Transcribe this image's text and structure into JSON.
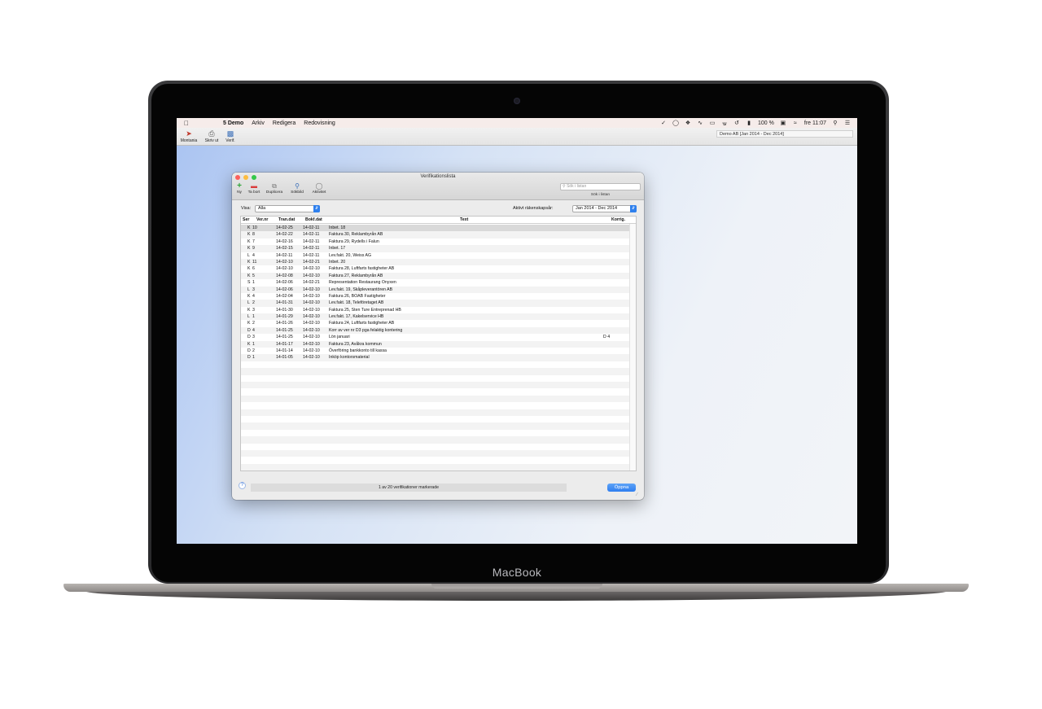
{
  "device": {
    "brand": "MacBook"
  },
  "menubar": {
    "apple_icon": "apple-icon",
    "app_name": "5 Demo",
    "menus": [
      "Arkiv",
      "Redigera",
      "Redovisning"
    ],
    "battery": "100 %",
    "clock": "fre 11:07"
  },
  "app_toolbar": {
    "buttons": [
      "Montania",
      "Skriv ut",
      "Verif."
    ],
    "company": "Demo AB [Jan 2014 - Dec 2014]"
  },
  "window": {
    "title": "Verifikationslista",
    "toolbar": [
      "Ny",
      "Ta bort",
      "Duplicera",
      "Sökbild",
      "Aktivitet"
    ],
    "search_placeholder": "Sök i listan",
    "search_label": "Sök i listan",
    "visa_label": "Visa:",
    "visa_value": "Alla",
    "aktivt_label": "Aktivt räkenskapsår:",
    "aktivt_value": "Jan 2014 - Dec 2014",
    "columns": {
      "ser": "Ser",
      "vernr": "Ver.nr",
      "trandat": "Tran.dat",
      "bokfdat": "Bokf.dat",
      "text": "Text",
      "korrig": "Korrig."
    },
    "rows": [
      {
        "ser": "K",
        "nr": "10",
        "tran": "14-02-25",
        "bokf": "14-02-11",
        "text": "Inbet. 18",
        "korrig": ""
      },
      {
        "ser": "K",
        "nr": "8",
        "tran": "14-02-22",
        "bokf": "14-02-11",
        "text": "Faktura 30, Reklambyrån AB",
        "korrig": ""
      },
      {
        "ser": "K",
        "nr": "7",
        "tran": "14-02-16",
        "bokf": "14-02-11",
        "text": "Faktura 29, Rydells i Falun",
        "korrig": ""
      },
      {
        "ser": "K",
        "nr": "9",
        "tran": "14-02-15",
        "bokf": "14-02-11",
        "text": "Inbet. 17",
        "korrig": ""
      },
      {
        "ser": "L",
        "nr": "4",
        "tran": "14-02-11",
        "bokf": "14-02-11",
        "text": "Lev.fakt. 20, Weiss AG",
        "korrig": ""
      },
      {
        "ser": "K",
        "nr": "11",
        "tran": "14-02-10",
        "bokf": "14-02-21",
        "text": "Inbet. 20",
        "korrig": ""
      },
      {
        "ser": "K",
        "nr": "6",
        "tran": "14-02-10",
        "bokf": "14-02-10",
        "text": "Faktura 28, Luftfarts fastigheter AB",
        "korrig": ""
      },
      {
        "ser": "K",
        "nr": "5",
        "tran": "14-02-08",
        "bokf": "14-02-10",
        "text": "Faktura 27, Reklambyrån AB",
        "korrig": ""
      },
      {
        "ser": "S",
        "nr": "1",
        "tran": "14-02-06",
        "bokf": "14-02-21",
        "text": "Representation Restaurang Onyxen",
        "korrig": ""
      },
      {
        "ser": "L",
        "nr": "3",
        "tran": "14-02-06",
        "bokf": "14-02-10",
        "text": "Lev.fakt. 19, Skåpleverantören AB",
        "korrig": ""
      },
      {
        "ser": "K",
        "nr": "4",
        "tran": "14-02-04",
        "bokf": "14-02-10",
        "text": "Faktura 26, BOAB Fastigheter",
        "korrig": ""
      },
      {
        "ser": "L",
        "nr": "2",
        "tran": "14-01-31",
        "bokf": "14-02-10",
        "text": "Lev.fakt. 18, Teleföretaget AB",
        "korrig": ""
      },
      {
        "ser": "K",
        "nr": "3",
        "tran": "14-01-30",
        "bokf": "14-02-10",
        "text": "Faktura 25, Sten Ture Entreprenad HB",
        "korrig": ""
      },
      {
        "ser": "L",
        "nr": "1",
        "tran": "14-01-29",
        "bokf": "14-02-10",
        "text": "Lev.fakt. 17, Kakelservice HB",
        "korrig": ""
      },
      {
        "ser": "K",
        "nr": "2",
        "tran": "14-01-26",
        "bokf": "14-02-10",
        "text": "Faktura 24, Luftfarts fastigheter AB",
        "korrig": ""
      },
      {
        "ser": "D",
        "nr": "4",
        "tran": "14-01-25",
        "bokf": "14-02-10",
        "text": "Korr av ver nr D3 pga felaktig kontering",
        "korrig": ""
      },
      {
        "ser": "D",
        "nr": "3",
        "tran": "14-01-25",
        "bokf": "14-02-10",
        "text": "Lön januari",
        "korrig": "D 4"
      },
      {
        "ser": "K",
        "nr": "1",
        "tran": "14-01-17",
        "bokf": "14-02-10",
        "text": "Faktura 23, Avåkra kommun",
        "korrig": ""
      },
      {
        "ser": "D",
        "nr": "2",
        "tran": "14-01-14",
        "bokf": "14-02-10",
        "text": "Överföring bankkonto till kassa",
        "korrig": ""
      },
      {
        "ser": "D",
        "nr": "1",
        "tran": "14-01-05",
        "bokf": "14-02-10",
        "text": "Inköp kontorsmaterial",
        "korrig": ""
      }
    ],
    "status": "1 av 20 verifikationer markerade",
    "open_button": "Öppna",
    "help": "?"
  },
  "colors": {
    "accent": "#2f7ef0",
    "close": "#fc605c",
    "minimize": "#fdbc40",
    "zoom": "#34c84a"
  }
}
